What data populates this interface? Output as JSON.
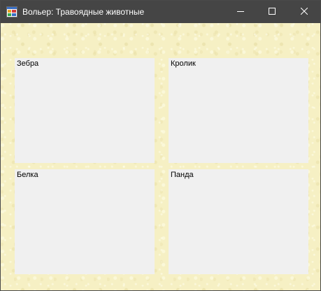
{
  "window": {
    "title": "Вольер: Травоядные животные",
    "icon": "app-form-icon",
    "controls": {
      "minimize": "minimize-icon",
      "maximize": "maximize-icon",
      "close": "close-icon"
    }
  },
  "colors": {
    "titlebar": "#454545",
    "client_background": "#f6f0c4",
    "panel_background": "#f0f0f0"
  },
  "panels": [
    {
      "label": "Зебра"
    },
    {
      "label": "Кролик"
    },
    {
      "label": "Белка"
    },
    {
      "label": "Панда"
    }
  ]
}
